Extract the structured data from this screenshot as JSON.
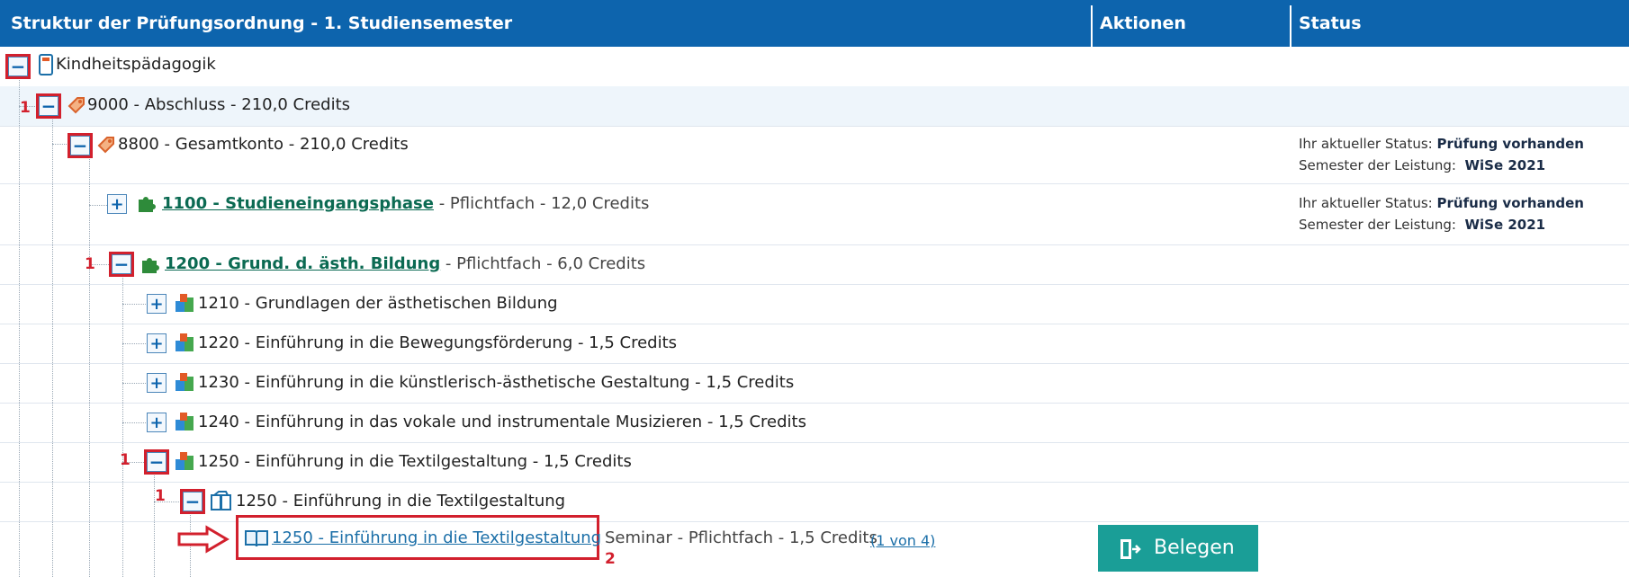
{
  "header": {
    "structure": "Struktur der Prüfungsordnung - 1. Studiensemester",
    "actions": "Aktionen",
    "status": "Status"
  },
  "colors": {
    "header": "#0d64ad",
    "link": "#1b6fa8",
    "highlight": "#d2202d",
    "button": "#1a9e97"
  },
  "rows": [
    {
      "id": "row-root",
      "text": "Kindheitspädagogik"
    },
    {
      "id": "row-9000",
      "text": "9000 - Abschluss - 210,0 Credits"
    },
    {
      "id": "row-8800",
      "text": "8800 - Gesamtkonto - 210,0 Credits",
      "status_label": "Ihr aktueller Status:",
      "status_value": "Prüfung vorhanden",
      "semester_label": "Semester der Leistung:",
      "semester_value": "WiSe 2021"
    },
    {
      "id": "row-1100",
      "link": "1100 - Studieneingangsphase",
      "rest": " - Pflichtfach - 12,0 Credits",
      "status_label": "Ihr aktueller Status:",
      "status_value": "Prüfung vorhanden",
      "semester_label": "Semester der Leistung:",
      "semester_value": "WiSe 2021"
    },
    {
      "id": "row-1200",
      "link": "1200 - Grund. d. ästh. Bildung",
      "rest": " - Pflichtfach - 6,0 Credits"
    },
    {
      "id": "row-1210",
      "text": "1210 - Grundlagen der ästhetischen Bildung"
    },
    {
      "id": "row-1220",
      "text": "1220 - Einführung in die Bewegungsförderung - 1,5 Credits"
    },
    {
      "id": "row-1230",
      "text": "1230 - Einführung in die künstlerisch-ästhetische Gestaltung - 1,5 Credits"
    },
    {
      "id": "row-1240",
      "text": "1240 - Einführung in das vokale und instrumentale Musizieren - 1,5 Credits"
    },
    {
      "id": "row-1250a",
      "text": "1250 - Einführung in die Textilgestaltung - 1,5 Credits"
    },
    {
      "id": "row-1250b",
      "text": "1250 - Einführung in die Textilgestaltung"
    },
    {
      "id": "row-1250c",
      "link": "1250 - Einführung in die Textilgestaltung",
      "rest": "Seminar - Pflichtfach - 1,5 Credits",
      "count": "(1 von 4)",
      "button": "Belegen"
    }
  ],
  "annotations": {
    "one": "1",
    "two": "2"
  },
  "icons": [
    "notebook-icon",
    "tag-icon",
    "puzzle-icon",
    "books-icon",
    "module-icon",
    "open-book-icon",
    "door-enter-icon",
    "red-arrow"
  ]
}
